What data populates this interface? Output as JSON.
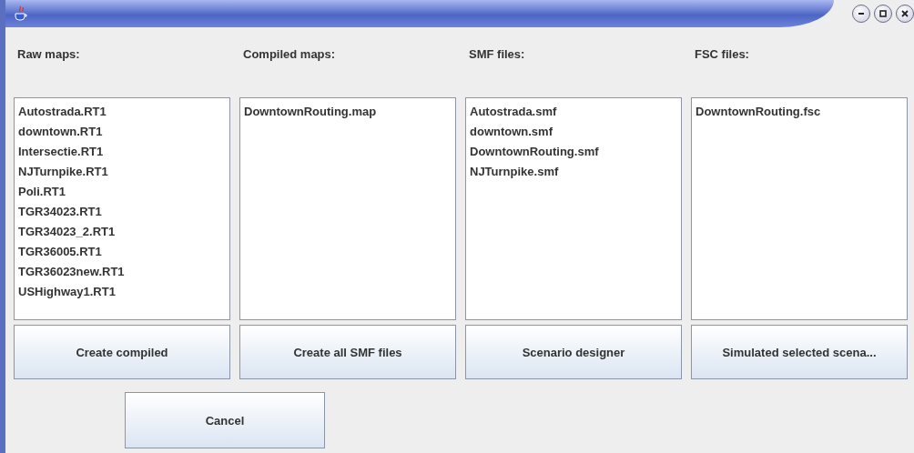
{
  "columns": [
    {
      "label": "Raw maps:",
      "items": [
        "Autostrada.RT1",
        "downtown.RT1",
        "Intersectie.RT1",
        "NJTurnpike.RT1",
        "Poli.RT1",
        "TGR34023.RT1",
        "TGR34023_2.RT1",
        "TGR36005.RT1",
        "TGR36023new.RT1",
        "USHighway1.RT1"
      ],
      "button": "Create compiled"
    },
    {
      "label": "Compiled maps:",
      "items": [
        "DowntownRouting.map"
      ],
      "button": "Create all SMF files"
    },
    {
      "label": "SMF files:",
      "items": [
        "Autostrada.smf",
        "downtown.smf",
        "DowntownRouting.smf",
        "NJTurnpike.smf"
      ],
      "button": "Scenario designer"
    },
    {
      "label": "FSC files:",
      "items": [
        "DowntownRouting.fsc"
      ],
      "button": "Simulated selected scena..."
    }
  ],
  "cancel_button": "Cancel"
}
